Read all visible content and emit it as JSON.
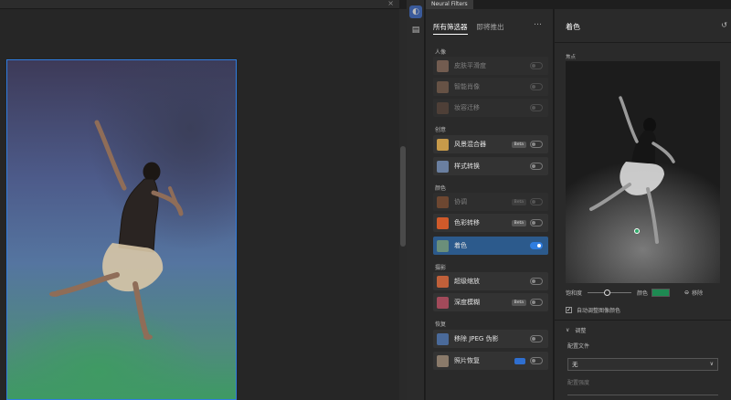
{
  "canvas": {
    "close_icon": "×"
  },
  "panel_tab": {
    "label": "Neural Filters"
  },
  "filters_panel": {
    "tab_all": "所有筛选器",
    "tab_coming": "即将推出",
    "more": "…",
    "categories": [
      {
        "name": "人像",
        "items": [
          {
            "label": "皮肤平滑度",
            "dim": true,
            "beta": false,
            "on": false,
            "thumb": "#c99a7e"
          },
          {
            "label": "智能肖像",
            "dim": true,
            "beta": false,
            "on": false,
            "thumb": "#b08466"
          },
          {
            "label": "妆容迁移",
            "dim": true,
            "beta": false,
            "on": false,
            "thumb": "#7a5a48"
          }
        ]
      },
      {
        "name": "创意",
        "items": [
          {
            "label": "风景混合器",
            "dim": false,
            "beta": true,
            "on": false,
            "thumb": "#c79a4a"
          },
          {
            "label": "样式转换",
            "dim": false,
            "beta": false,
            "on": false,
            "thumb": "#6a7fa0"
          }
        ]
      },
      {
        "name": "颜色",
        "items": [
          {
            "label": "协调",
            "dim": true,
            "beta": true,
            "on": false,
            "thumb": "#c06a3a"
          },
          {
            "label": "色彩转移",
            "dim": false,
            "beta": true,
            "on": false,
            "thumb": "#d05a2a"
          },
          {
            "label": "着色",
            "dim": false,
            "beta": false,
            "on": true,
            "selected": true,
            "thumb": "#6b8f7a"
          }
        ]
      },
      {
        "name": "摄影",
        "items": [
          {
            "label": "超级缩放",
            "dim": false,
            "beta": false,
            "on": false,
            "thumb": "#c0603a"
          },
          {
            "label": "深度模糊",
            "dim": false,
            "beta": true,
            "on": false,
            "thumb": "#a24a5a"
          }
        ]
      },
      {
        "name": "恢复",
        "items": [
          {
            "label": "移除 JPEG 伪影",
            "dim": false,
            "beta": false,
            "on": false,
            "thumb": "#4a6a9a"
          },
          {
            "label": "照片恢复",
            "dim": false,
            "beta": false,
            "on": false,
            "blue_button": true,
            "thumb": "#8a7a6a"
          }
        ]
      }
    ],
    "beta_label": "Beta"
  },
  "detail": {
    "title": "着色",
    "reset_icon": "↺",
    "focus_label": "焦点",
    "saturation_label": "饱和度",
    "color_label": "颜色",
    "swatch_color": "#1e8a52",
    "remove_label": "移除",
    "remove_icon": "⊖",
    "auto_color_label": "自动调整图像颜色",
    "auto_color_checked": true,
    "adjust_label": "调整",
    "profile_label": "配置文件",
    "profile_value": "无",
    "profile_strength_label": "配置强度",
    "collapse_icon": "∨",
    "select_arrow": "∨"
  },
  "colors": {
    "accent": "#2f7de0",
    "selected_item": "#2c5a8c"
  }
}
